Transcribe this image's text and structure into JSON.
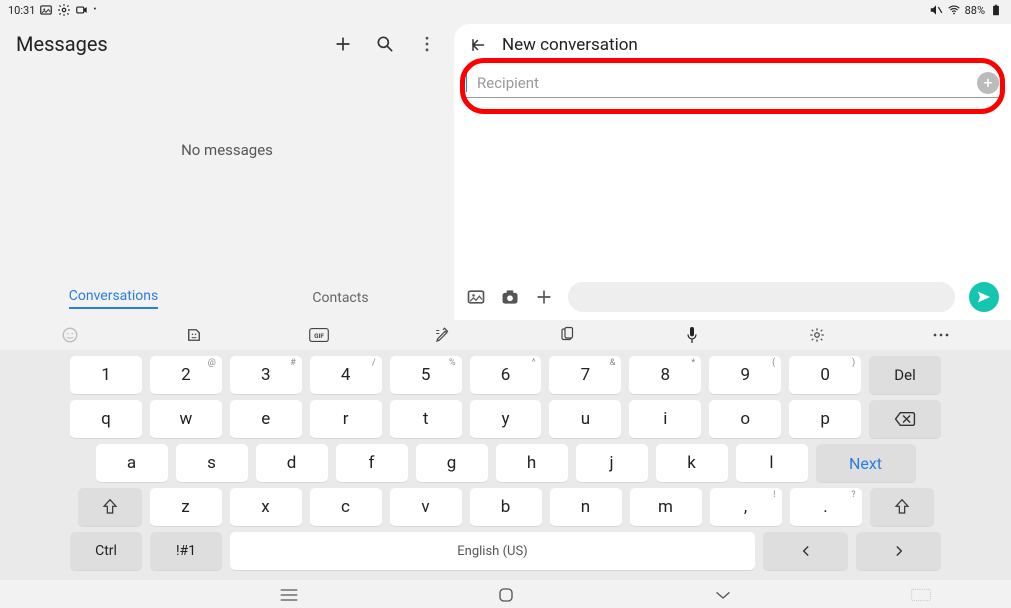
{
  "status": {
    "time": "10:31",
    "battery_pct": "88%"
  },
  "left": {
    "title": "Messages",
    "empty_text": "No messages",
    "tabs": {
      "conversations": "Conversations",
      "contacts": "Contacts"
    }
  },
  "right": {
    "title": "New conversation",
    "recipient_placeholder": "Recipient"
  },
  "keyboard": {
    "row1": [
      {
        "label": "1",
        "sup": ""
      },
      {
        "label": "2",
        "sup": "@"
      },
      {
        "label": "3",
        "sup": "#"
      },
      {
        "label": "4",
        "sup": "/"
      },
      {
        "label": "5",
        "sup": "%"
      },
      {
        "label": "6",
        "sup": "^"
      },
      {
        "label": "7",
        "sup": "&"
      },
      {
        "label": "8",
        "sup": "*"
      },
      {
        "label": "9",
        "sup": "("
      },
      {
        "label": "0",
        "sup": ")"
      }
    ],
    "row2": [
      "q",
      "w",
      "e",
      "r",
      "t",
      "y",
      "u",
      "i",
      "o",
      "p"
    ],
    "row3": [
      "a",
      "s",
      "d",
      "f",
      "g",
      "h",
      "j",
      "k",
      "l"
    ],
    "row4_letters": [
      "z",
      "x",
      "c",
      "v",
      "b",
      "n",
      "m"
    ],
    "comma": {
      "label": ",",
      "sup": "!"
    },
    "period": {
      "label": ".",
      "sup": "?"
    },
    "del": "Del",
    "next": "Next",
    "ctrl": "Ctrl",
    "sym": "!#1",
    "space": "English (US)",
    "left_arrow": "<",
    "right_arrow": ">"
  }
}
